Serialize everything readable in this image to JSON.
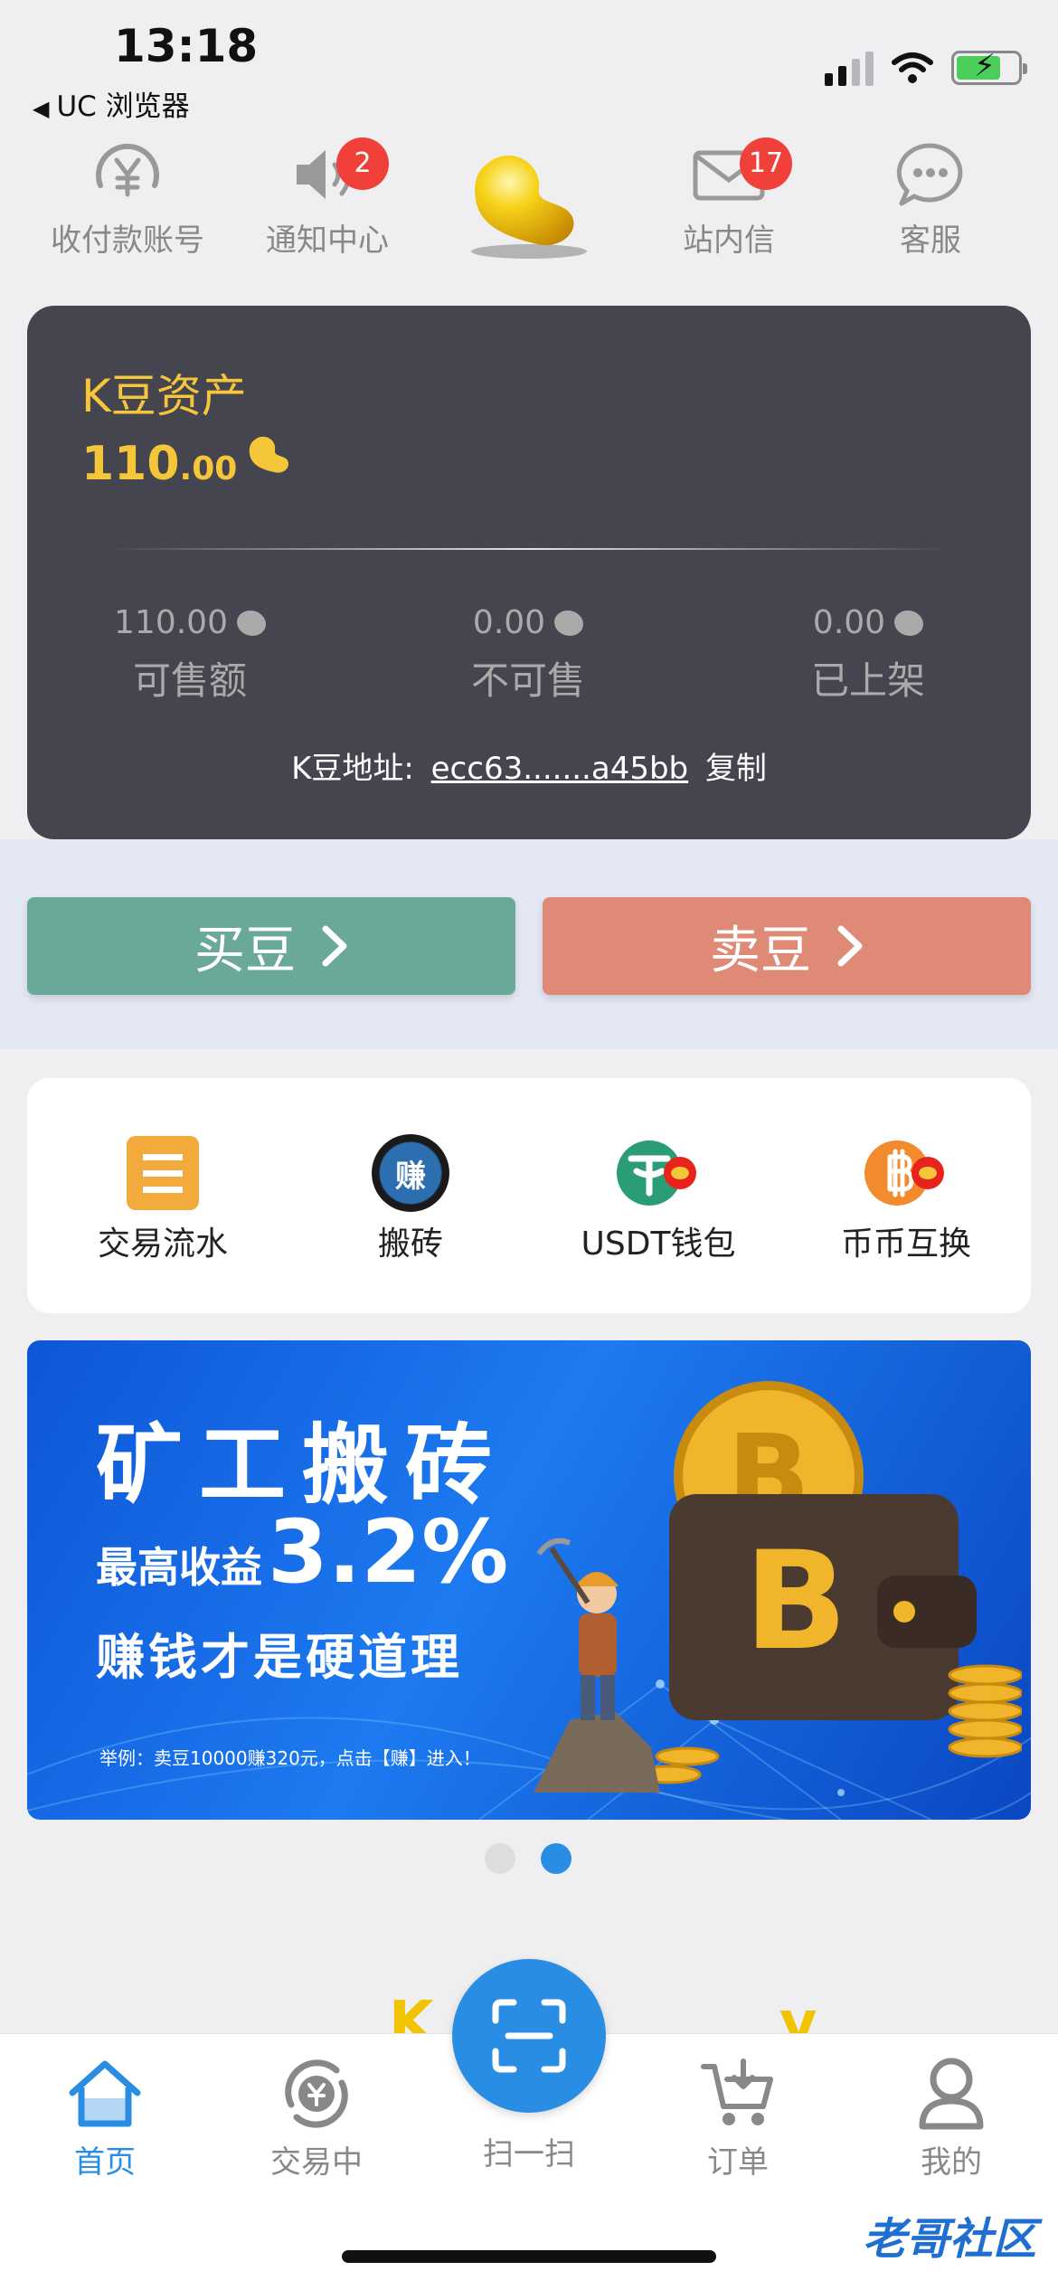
{
  "status_bar": {
    "time": "13:18",
    "back_app": "UC 浏览器",
    "back_icon": "back-triangle-icon"
  },
  "top_nav": {
    "items": [
      {
        "label": "收付款账号",
        "icon": "yen-coin-icon"
      },
      {
        "label": "通知中心",
        "icon": "speaker-icon",
        "badge": "2"
      },
      {
        "label": "站内信",
        "icon": "envelope-icon",
        "badge": "17"
      },
      {
        "label": "客服",
        "icon": "chat-bubble-icon"
      }
    ],
    "logo_icon": "golden-bean-icon"
  },
  "asset_card": {
    "title": "K豆资产",
    "total_int": "110",
    "total_dec": ".00",
    "stats": [
      {
        "value": "110.00",
        "label": "可售额"
      },
      {
        "value": "0.00",
        "label": "不可售"
      },
      {
        "value": "0.00",
        "label": "已上架"
      }
    ],
    "address_label": "K豆地址:",
    "address_value": "ecc63.......a45bb",
    "copy_label": "复制"
  },
  "actions": {
    "buy_label": "买豆",
    "sell_label": "卖豆"
  },
  "quick_actions": [
    {
      "label": "交易流水",
      "icon": "ledger-icon"
    },
    {
      "label": "搬砖",
      "icon": "earn-badge-icon",
      "icon_text": "赚"
    },
    {
      "label": "USDT钱包",
      "icon": "tether-icon"
    },
    {
      "label": "币币互换",
      "icon": "bitcoin-swap-icon"
    }
  ],
  "banner": {
    "headline": "矿工搬砖",
    "yield_prefix": "最高收益",
    "yield_value": "3.2%",
    "tagline": "赚钱才是硬道理",
    "note": "举例：卖豆10000赚320元，点击【赚】进入！"
  },
  "carousel": {
    "total": 2,
    "active_index": 1
  },
  "peek_text": "K  y",
  "tab_bar": {
    "tabs": [
      {
        "label": "首页",
        "icon": "home-icon",
        "active": true
      },
      {
        "label": "交易中",
        "icon": "yen-cycle-icon",
        "active": false
      },
      {
        "label": "订单",
        "icon": "cart-icon",
        "active": false
      },
      {
        "label": "我的",
        "icon": "profile-icon",
        "active": false
      }
    ],
    "scan_label": "扫一扫"
  },
  "watermark": "老哥社区",
  "colors": {
    "accent_blue": "#2a8de4",
    "gold": "#f5c53a",
    "card_dark": "#454550",
    "buy_green": "#6aa89a",
    "sell_salmon": "#de8a77",
    "badge_red": "#f0403a"
  }
}
